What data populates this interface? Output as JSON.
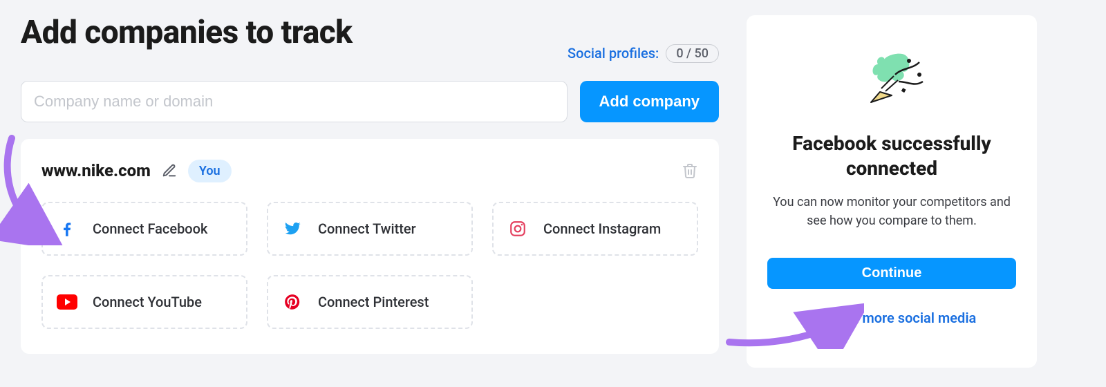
{
  "header": {
    "title": "Add companies to track",
    "social_label": "Social profiles:",
    "social_count": "0 / 50"
  },
  "input": {
    "placeholder": "Company name or domain",
    "add_label": "Add company"
  },
  "company": {
    "domain": "www.nike.com",
    "you_label": "You"
  },
  "connect": {
    "facebook": "Connect Facebook",
    "twitter": "Connect Twitter",
    "instagram": "Connect Instagram",
    "youtube": "Connect YouTube",
    "pinterest": "Connect Pinterest"
  },
  "panel": {
    "title": "Facebook successfully connected",
    "desc": "You can now monitor your competitors and see how you compare to them.",
    "continue": "Continue",
    "more": "Connect more social media"
  },
  "colors": {
    "accent": "#0696ff",
    "link": "#1a6fe0",
    "annotation": "#a974ef"
  }
}
